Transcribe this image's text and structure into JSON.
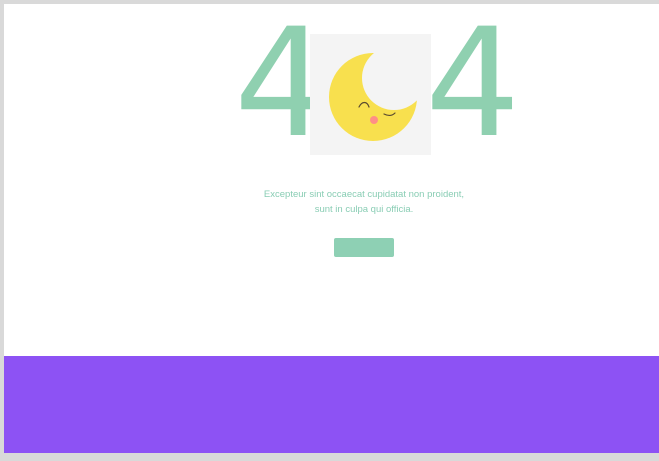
{
  "digits": {
    "left": "4",
    "right": "4"
  },
  "illustration": {
    "icon": "moon-icon",
    "colors": {
      "card": "#f4f4f4",
      "moon": "#f8e04e",
      "face_line": "#5a4a2f",
      "cheek": "#ff8f86"
    }
  },
  "message": {
    "line1": "Excepteur sint occaecat cupidatat non proident,",
    "line2": "sunt in culpa qui officia."
  },
  "button": {
    "label": ""
  },
  "colors": {
    "accent": "#8fd0b0",
    "footer": "#8d52f4",
    "background": "#ffffff"
  }
}
